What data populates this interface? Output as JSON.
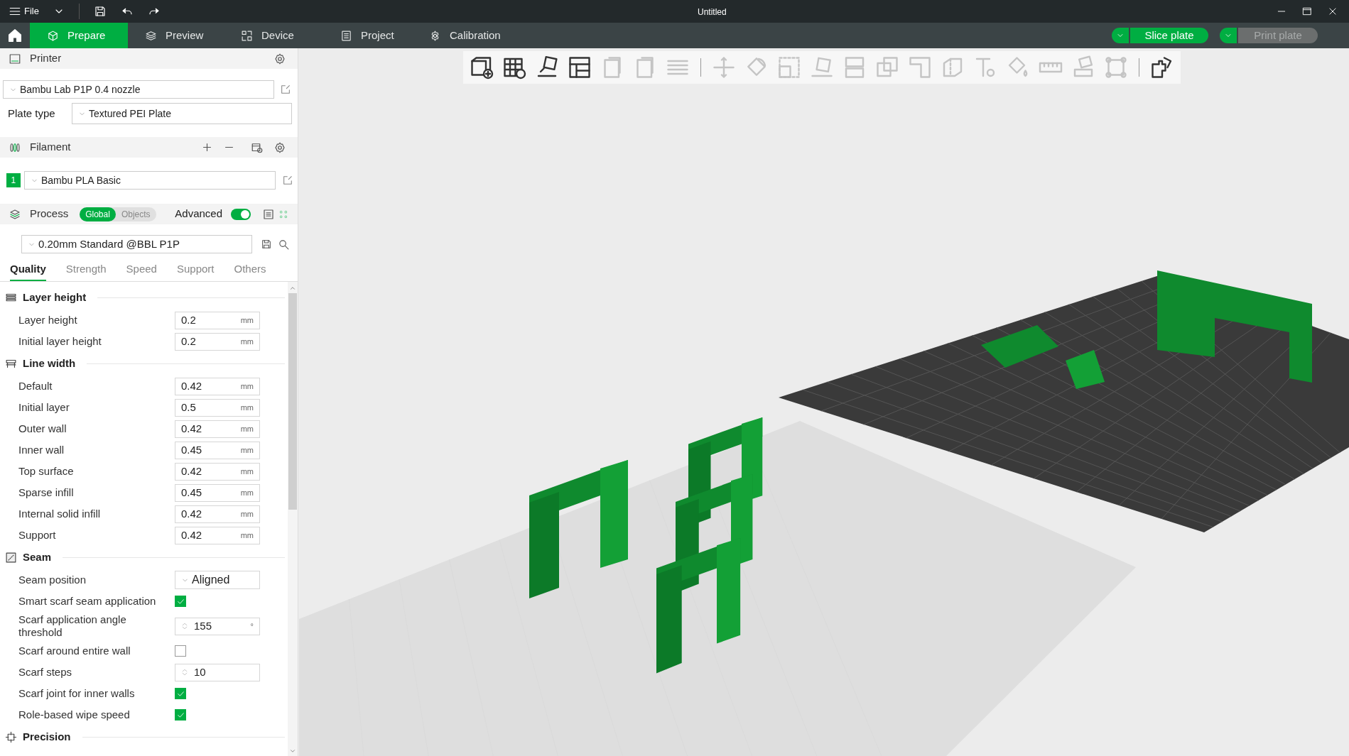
{
  "title_bar": {
    "menu": "File",
    "title": "Untitled"
  },
  "tabs": [
    {
      "label": "Prepare",
      "selected": true
    },
    {
      "label": "Preview",
      "selected": false
    },
    {
      "label": "Device",
      "selected": false
    },
    {
      "label": "Project",
      "selected": false
    },
    {
      "label": "Calibration",
      "selected": false
    }
  ],
  "actions": [
    {
      "label": "Slice plate",
      "disabled": false
    },
    {
      "label": "Print plate",
      "disabled": true
    }
  ],
  "printer": {
    "title": "Printer",
    "preset": "Bambu Lab P1P 0.4 nozzle",
    "plate_type_label": "Plate type",
    "plate_type": "Textured PEI Plate"
  },
  "filament": {
    "title": "Filament",
    "items": [
      {
        "index": "1",
        "name": "Bambu PLA Basic",
        "color": "#00ae42"
      }
    ]
  },
  "process": {
    "title": "Process",
    "scope": [
      {
        "label": "Global",
        "selected": true
      },
      {
        "label": "Objects",
        "selected": false
      }
    ],
    "advanced_label": "Advanced",
    "advanced_on": true,
    "preset": "0.20mm Standard @BBL P1P"
  },
  "setting_tabs": [
    {
      "label": "Quality",
      "selected": true
    },
    {
      "label": "Strength",
      "selected": false
    },
    {
      "label": "Speed",
      "selected": false
    },
    {
      "label": "Support",
      "selected": false
    },
    {
      "label": "Others",
      "selected": false
    }
  ],
  "sections": [
    {
      "title": "Layer height",
      "rows": [
        {
          "kind": "number",
          "label": "Layer height",
          "value": "0.2",
          "unit": "mm"
        },
        {
          "kind": "number",
          "label": "Initial layer height",
          "value": "0.2",
          "unit": "mm"
        }
      ]
    },
    {
      "title": "Line width",
      "rows": [
        {
          "kind": "number",
          "label": "Default",
          "value": "0.42",
          "unit": "mm"
        },
        {
          "kind": "number",
          "label": "Initial layer",
          "value": "0.5",
          "unit": "mm"
        },
        {
          "kind": "number",
          "label": "Outer wall",
          "value": "0.42",
          "unit": "mm"
        },
        {
          "kind": "number",
          "label": "Inner wall",
          "value": "0.45",
          "unit": "mm"
        },
        {
          "kind": "number",
          "label": "Top surface",
          "value": "0.42",
          "unit": "mm"
        },
        {
          "kind": "number",
          "label": "Sparse infill",
          "value": "0.45",
          "unit": "mm"
        },
        {
          "kind": "number",
          "label": "Internal solid infill",
          "value": "0.42",
          "unit": "mm"
        },
        {
          "kind": "number",
          "label": "Support",
          "value": "0.42",
          "unit": "mm"
        }
      ]
    },
    {
      "title": "Seam",
      "rows": [
        {
          "kind": "select",
          "label": "Seam position",
          "value": "Aligned"
        },
        {
          "kind": "checkbox",
          "label": "Smart scarf seam application",
          "checked": true
        },
        {
          "kind": "spin",
          "label": "Scarf application angle threshold",
          "value": "155",
          "unit": "°"
        },
        {
          "kind": "checkbox",
          "label": "Scarf around entire wall",
          "checked": false
        },
        {
          "kind": "spin",
          "label": "Scarf steps",
          "value": "10"
        },
        {
          "kind": "checkbox",
          "label": "Scarf joint for inner walls",
          "checked": true
        },
        {
          "kind": "checkbox",
          "label": "Role-based wipe speed",
          "checked": true
        }
      ]
    },
    {
      "title": "Precision"
    }
  ]
}
